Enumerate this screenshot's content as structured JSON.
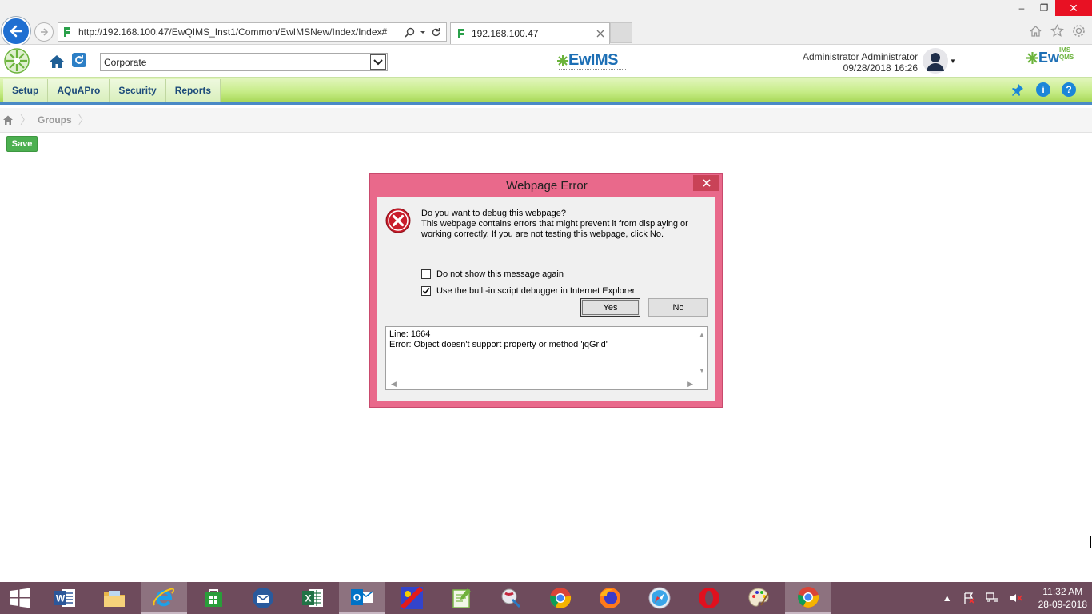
{
  "browser": {
    "url": "http://192.168.100.47/EwQIMS_Inst1/Common/EwIMSNew/Index/Index#",
    "tab_title": "192.168.100.47",
    "window_controls": {
      "minimize": "–",
      "maximize": "❐",
      "close": "✕"
    }
  },
  "app": {
    "org_select": {
      "value": "Corporate"
    },
    "center_logo_text": "EwIMS",
    "right_logo_text": "Ew",
    "right_logo_sup": "IMS\nQMS",
    "user_name": "Administrator Administrator",
    "datetime": "09/28/2018 16:26"
  },
  "menu": {
    "items": [
      {
        "label": "Setup"
      },
      {
        "label": "AQuAPro"
      },
      {
        "label": "Security"
      },
      {
        "label": "Reports"
      }
    ]
  },
  "breadcrumb": {
    "current": "Groups"
  },
  "toolbar": {
    "save_label": "Save"
  },
  "dialog": {
    "title": "Webpage Error",
    "question": "Do you want to debug this webpage?",
    "detail": "This webpage contains errors that might prevent it from displaying or working correctly. If you are not testing this webpage, click No.",
    "checkboxes": [
      {
        "label": "Do not show this message again",
        "checked": false
      },
      {
        "label": "Use the built-in script debugger in Internet Explorer",
        "checked": true
      }
    ],
    "yes_label": "Yes",
    "no_label": "No",
    "error_line": "Line: 1664",
    "error_text": "Error: Object doesn't support property or method 'jqGrid'"
  },
  "taskbar": {
    "apps": [
      "word",
      "file-explorer",
      "internet-explorer",
      "store",
      "thunderbird",
      "excel",
      "outlook",
      "app-red",
      "notepad-plus",
      "app-paint",
      "chrome",
      "firefox",
      "safari",
      "opera",
      "paint",
      "chrome-2"
    ],
    "time": "11:32 AM",
    "date": "28-09-2018"
  },
  "colors": {
    "dialog_frame": "#e9698b",
    "menubar_green": "#c6ec86",
    "taskbar": "#6e4b5c",
    "save_green": "#4caf50"
  }
}
